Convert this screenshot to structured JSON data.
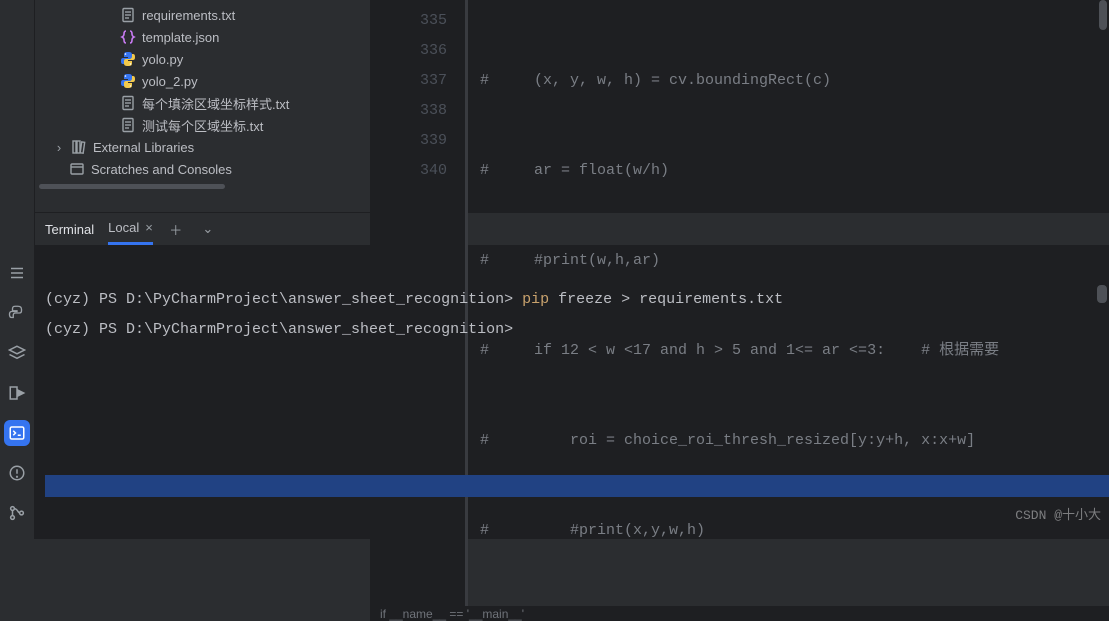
{
  "sidebar": {
    "items": [
      {
        "name": "requirements.txt",
        "icon": "text"
      },
      {
        "name": "template.json",
        "icon": "json"
      },
      {
        "name": "yolo.py",
        "icon": "py"
      },
      {
        "name": "yolo_2.py",
        "icon": "py"
      },
      {
        "name": "每个填涂区域坐标样式.txt",
        "icon": "text"
      },
      {
        "name": "测试每个区域坐标.txt",
        "icon": "text"
      }
    ],
    "external": "External Libraries",
    "scratches": "Scratches and Consoles"
  },
  "editor": {
    "lines": [
      {
        "num": "335",
        "text": "#     (x, y, w, h) = cv.boundingRect(c)"
      },
      {
        "num": "336",
        "text": "#     ar = float(w/h)"
      },
      {
        "num": "337",
        "text": "#     #print(w,h,ar)"
      },
      {
        "num": "338",
        "text": "#     if 12 < w <17 and h > 5 and 1<= ar <=3:    # 根据需要"
      },
      {
        "num": "339",
        "text": "#         roi = choice_roi_thresh_resized[y:y+h, x:x+w]"
      },
      {
        "num": "340",
        "text": "#         #print(x,y,w,h)"
      }
    ],
    "breadcrumb": "if __name__ == '__main__'"
  },
  "terminal": {
    "title": "Terminal",
    "tab": "Local",
    "lines": [
      {
        "prompt": "(cyz) PS D:\\PyCharmProject\\answer_sheet_recognition>",
        "cmd_hl": "pip",
        "cmd_rest": " freeze > requirements.txt"
      },
      {
        "prompt": "(cyz) PS D:\\PyCharmProject\\answer_sheet_recognition>",
        "cmd_hl": "",
        "cmd_rest": ""
      }
    ]
  },
  "watermark": "CSDN @十小大"
}
